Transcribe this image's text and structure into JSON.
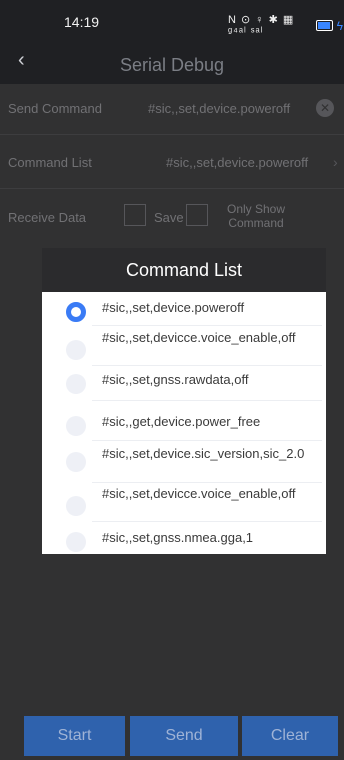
{
  "status_bar": {
    "time": "14:19",
    "icons": "N ⊙ ♀ ✱ ▦ ᵍ⁴ᵃˡ ˢᵃˡ"
  },
  "header": {
    "back_glyph": "‹",
    "title": "Serial Debug"
  },
  "send_command": {
    "label": "Send Command",
    "value": "#sic,,set,device.poweroff",
    "clear_glyph": "✕"
  },
  "command_list": {
    "label": "Command List",
    "value": "#sic,,set,device.poweroff",
    "chevron": "›"
  },
  "receive": {
    "label": "Receive Data",
    "save_label": "Save",
    "only_show_label": "Only Show Command"
  },
  "dialog": {
    "title": "Command List",
    "options": [
      {
        "label": "#sic,,set,device.poweroff",
        "selected": true
      },
      {
        "label": "#sic,,set,devicce.voice_enable,off",
        "selected": false
      },
      {
        "label": "#sic,,set,gnss.rawdata,off",
        "selected": false
      },
      {
        "label": "#sic,,get,device.power_free",
        "selected": false
      },
      {
        "label": "#sic,,set,device.sic_version,sic_2.0",
        "selected": false
      },
      {
        "label": "#sic,,set,devicce.voice_enable,off",
        "selected": false
      },
      {
        "label": "#sic,,set,gnss.nmea.gga,1",
        "selected": false
      }
    ]
  },
  "buttons": {
    "start": "Start",
    "send": "Send",
    "clear": "Clear"
  }
}
